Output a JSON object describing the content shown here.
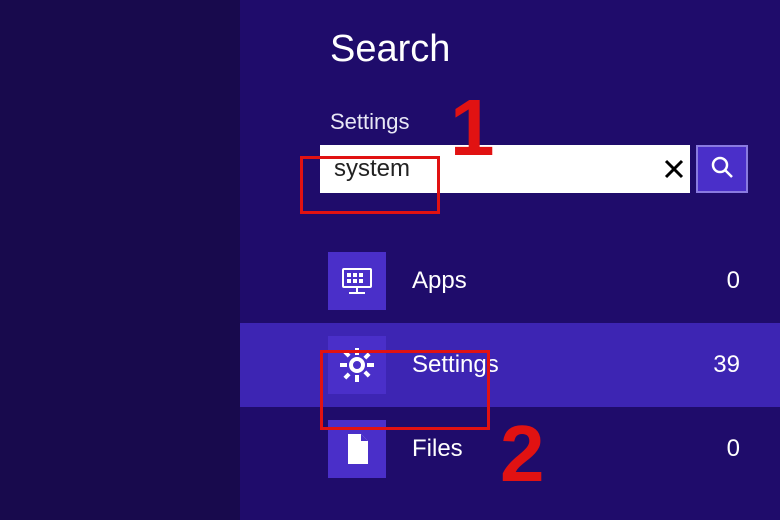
{
  "title": "Search",
  "scope": "Settings",
  "search": {
    "value": "system",
    "placeholder": ""
  },
  "categories": [
    {
      "id": "apps",
      "label": "Apps",
      "count": 0,
      "icon": "apps-icon",
      "selected": false
    },
    {
      "id": "settings",
      "label": "Settings",
      "count": 39,
      "icon": "gear-icon",
      "selected": true
    },
    {
      "id": "files",
      "label": "Files",
      "count": 0,
      "icon": "file-icon",
      "selected": false
    }
  ],
  "annotations": {
    "callout1": "1",
    "callout2": "2"
  },
  "colors": {
    "panel_bg": "#1f0c6b",
    "selected_bg": "#3d25b3",
    "icon_bg": "#4a2fc9",
    "annotation": "#e11212"
  }
}
